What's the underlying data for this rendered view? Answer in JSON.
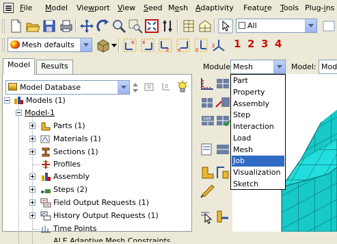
{
  "menubar": {
    "items": [
      {
        "label": "File",
        "ul": "F",
        "rest": "ile"
      },
      {
        "label": "Model",
        "ul": "M",
        "rest": "odel"
      },
      {
        "label": "Viewport",
        "pre": "Vie",
        "ul": "w",
        "rest": "port"
      },
      {
        "label": "View",
        "ul": "V",
        "rest": "iew"
      },
      {
        "label": "Seed",
        "ul": "S",
        "rest": "eed"
      },
      {
        "label": "Mesh",
        "pre": "M",
        "ul": "e",
        "rest": "sh"
      },
      {
        "label": "Adaptivity",
        "ul": "A",
        "rest": "daptivity"
      },
      {
        "label": "Feature",
        "pre": "Featu",
        "ul": "r",
        "rest": "e"
      },
      {
        "label": "Tools",
        "ul": "T",
        "rest": "ools"
      },
      {
        "label": "Plug-ins",
        "pre": "Plug-",
        "ul": "i",
        "rest": "ns"
      }
    ]
  },
  "toolbar1": {
    "selection_filter": "All"
  },
  "toolbar2": {
    "mesh_defaults": "Mesh defaults",
    "coord_numbers": [
      "1",
      "2",
      "3",
      "4"
    ]
  },
  "tabs": {
    "model": "Model",
    "results": "Results"
  },
  "tree": {
    "database": "Model Database",
    "models": "Models (1)",
    "model1": "Model-1",
    "parts": "Parts (1)",
    "materials": "Materials (1)",
    "sections": "Sections (1)",
    "profiles": "Profiles",
    "assembly": "Assembly",
    "steps": "Steps (2)",
    "field_output": "Field Output Requests (1)",
    "history_output": "History Output Requests (1)",
    "time_points": "Time Points",
    "partial": "ALE Adaptive Mesh Constraints"
  },
  "context": {
    "module_label": "Module:",
    "module_value": "Mesh",
    "model_label": "Model:",
    "model_value": "Mod"
  },
  "module_options": [
    "Part",
    "Property",
    "Assembly",
    "Step",
    "Interaction",
    "Load",
    "Mesh",
    "Job",
    "Visualization",
    "Sketch"
  ],
  "module_selected_index": 7,
  "colors": {
    "selection": "#316ac5",
    "mesh_face": "#1fd6d6",
    "coord_red": "#cc1010"
  }
}
